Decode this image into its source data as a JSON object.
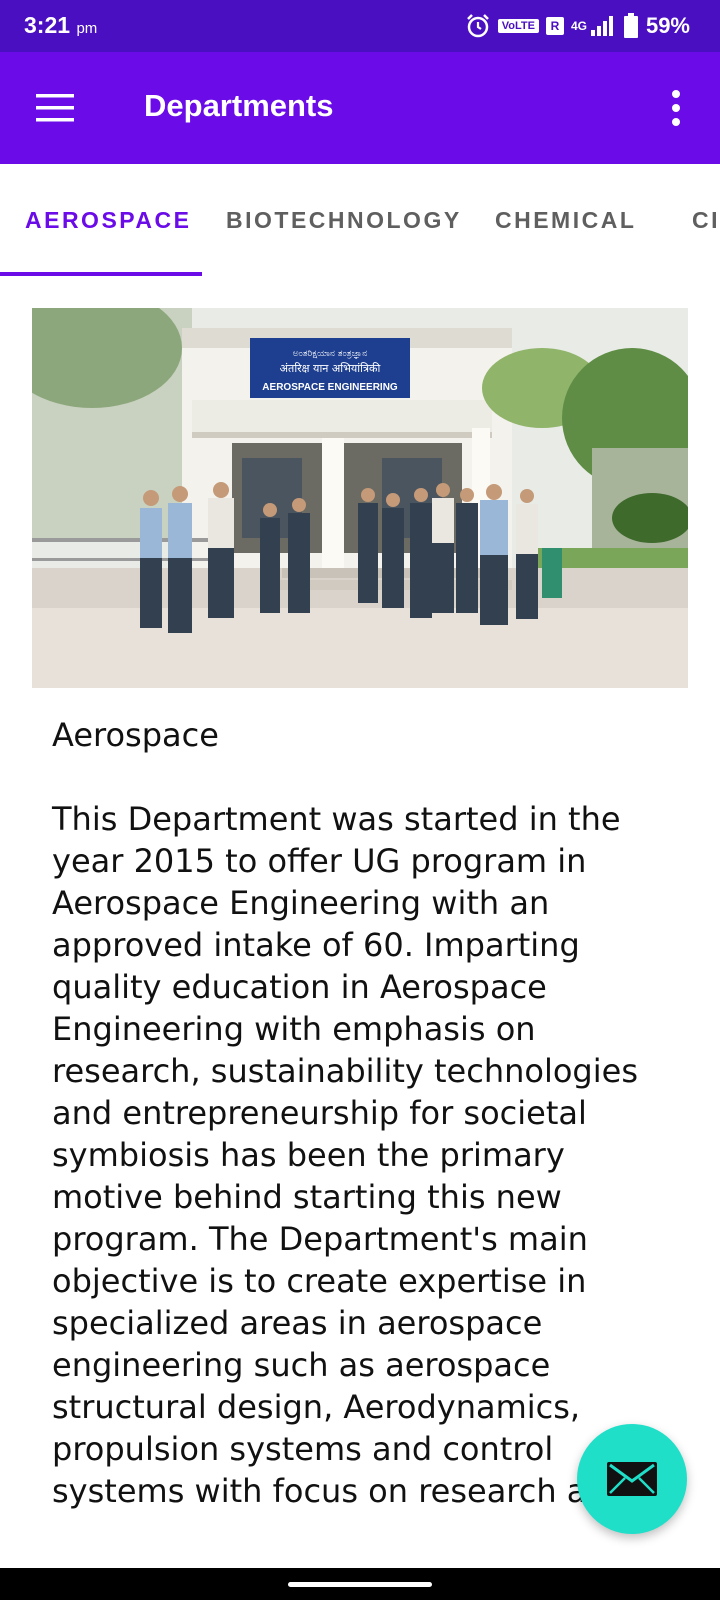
{
  "status_bar": {
    "time": "3:21",
    "ampm": "pm",
    "volte": "VoLTE",
    "roaming": "R",
    "network": "4G",
    "battery": "59%",
    "icons": [
      "alarm-icon",
      "signal-icon",
      "battery-icon"
    ]
  },
  "app_bar": {
    "title": "Departments",
    "menu_icon": "hamburger-menu-icon",
    "overflow_icon": "more-vert-icon"
  },
  "tabs": [
    {
      "label": "AEROSPACE",
      "active": true
    },
    {
      "label": "BIOTECHNOLOGY",
      "active": false
    },
    {
      "label": "CHEMICAL",
      "active": false
    },
    {
      "label": "CI",
      "active": false
    }
  ],
  "hero": {
    "sign_line1": "ಅಂತರಿಕ್ಷಯಾನ ತಂತ್ರಜ್ಞಾನ",
    "sign_line2": "अंतरिक्ष यान अभियांत्रिकी",
    "sign_line3": "AEROSPACE ENGINEERING"
  },
  "department": {
    "name": "Aerospace",
    "description": " This Department was started in the year 2015 to offer UG program in Aerospace Engineering with an approved intake of 60. Imparting quality education in Aerospace Engineering with emphasis on research, sustainability technologies and entrepreneurship for societal symbiosis has been the primary motive behind starting this new program. The Department's main objective is to create expertise in specialized areas in aerospace engineering such as aerospace structural design, Aerodynamics, propulsion systems and control systems with focus on research a"
  },
  "fab": {
    "icon": "mail-icon"
  },
  "colors": {
    "status_bar": "#4a0fc0",
    "primary": "#6a0be8",
    "accent": "#1fdfc9",
    "tab_inactive": "#5f5f5f"
  }
}
